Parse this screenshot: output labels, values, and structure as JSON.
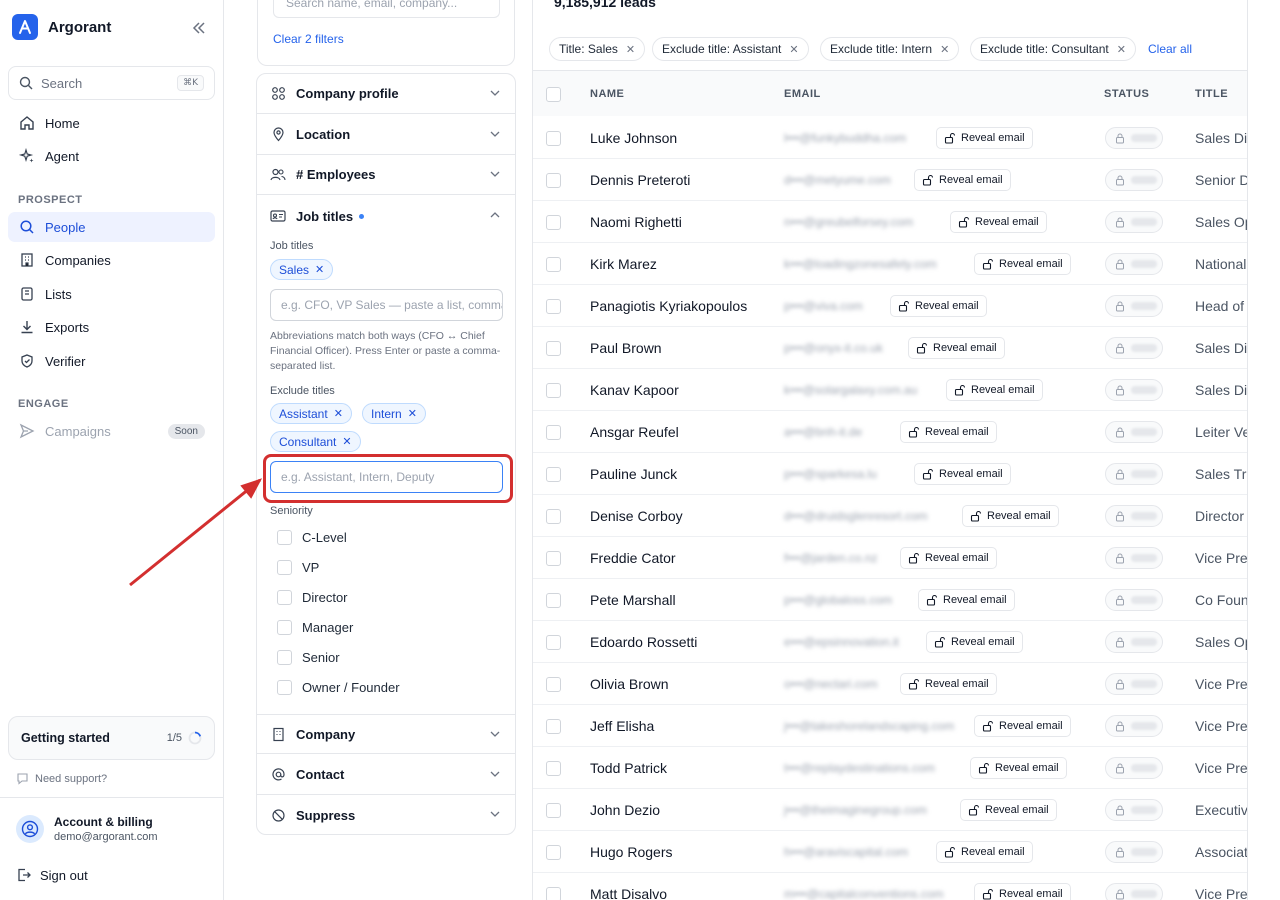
{
  "sidebar": {
    "brand": "Argorant",
    "search_label": "Search",
    "search_kbd": "⌘K",
    "nav_top": [
      {
        "label": "Home",
        "icon": "home-icon"
      },
      {
        "label": "Agent",
        "icon": "sparkle-icon"
      }
    ],
    "prospect_label": "PROSPECT",
    "nav_prospect": [
      {
        "label": "People",
        "icon": "search-icon",
        "active": true
      },
      {
        "label": "Companies",
        "icon": "building-icon"
      },
      {
        "label": "Lists",
        "icon": "list-icon"
      },
      {
        "label": "Exports",
        "icon": "download-icon"
      },
      {
        "label": "Verifier",
        "icon": "shield-icon"
      }
    ],
    "engage_label": "ENGAGE",
    "campaigns_label": "Campaigns",
    "campaigns_badge": "Soon",
    "getting_started": {
      "title": "Getting started",
      "progress": "1/5"
    },
    "support": "Need support?",
    "account_title": "Account & billing",
    "account_email": "demo@argorant.com",
    "signout": "Sign out"
  },
  "filters": {
    "search_placeholder": "Search name, email, company...",
    "clear_filters": "Clear 2 filters",
    "sections": {
      "company_profile": "Company profile",
      "location": "Location",
      "employees": "# Employees",
      "job_titles": "Job titles",
      "company": "Company",
      "contact": "Contact",
      "suppress": "Suppress"
    },
    "job_titles_label": "Job titles",
    "job_titles_chips": [
      "Sales"
    ],
    "job_titles_placeholder": "e.g. CFO, VP Sales — paste a list, comma-separated",
    "help_text": "Abbreviations match both ways (CFO ↔ Chief Financial Officer). Press Enter or paste a comma-separated list.",
    "exclude_label": "Exclude titles",
    "exclude_chips": [
      "Assistant",
      "Intern",
      "Consultant"
    ],
    "exclude_placeholder": "e.g. Assistant, Intern, Deputy",
    "seniority_label": "Seniority",
    "seniority_options": [
      "C-Level",
      "VP",
      "Director",
      "Manager",
      "Senior",
      "Owner / Founder"
    ]
  },
  "main": {
    "lead_count": "9,185,912 leads",
    "active_filters": [
      "Title: Sales",
      "Exclude title: Assistant",
      "Exclude title: Intern",
      "Exclude title: Consultant"
    ],
    "clear_all": "Clear all",
    "columns": [
      "NAME",
      "EMAIL",
      "STATUS",
      "TITLE"
    ],
    "reveal_label": "Reveal email",
    "rows": [
      {
        "name": "Luke Johnson",
        "email": "l•••@funkybuddha.com",
        "title": "Sales Director"
      },
      {
        "name": "Dennis Preteroti",
        "email": "d•••@metyume.com",
        "title": "Senior Director"
      },
      {
        "name": "Naomi Righetti",
        "email": "n•••@greubelforsey.com",
        "title": "Sales Operations"
      },
      {
        "name": "Kirk Marez",
        "email": "k•••@loadingzonesafety.com",
        "title": "National Sales"
      },
      {
        "name": "Panagiotis Kyriakopoulos",
        "email": "p•••@viva.com",
        "title": "Head of Sales"
      },
      {
        "name": "Paul Brown",
        "email": "p•••@onyx-it.co.uk",
        "title": "Sales Director"
      },
      {
        "name": "Kanav Kapoor",
        "email": "k•••@solargalaxy.com.au",
        "title": "Sales Director"
      },
      {
        "name": "Ansgar Reufel",
        "email": "a•••@bnh-it.de",
        "title": "Leiter Vertrieb"
      },
      {
        "name": "Pauline Junck",
        "email": "p•••@sparkesa.lu",
        "title": "Sales Trainer"
      },
      {
        "name": "Denise Corboy",
        "email": "d•••@druidsglenresort.com",
        "title": "Director of Sales"
      },
      {
        "name": "Freddie Cator",
        "email": "f•••@jarden.co.nz",
        "title": "Vice President"
      },
      {
        "name": "Pete Marshall",
        "email": "p•••@globaloss.com",
        "title": "Co Founder"
      },
      {
        "name": "Edoardo Rossetti",
        "email": "e•••@epsinnovation.it",
        "title": "Sales Operations"
      },
      {
        "name": "Olivia Brown",
        "email": "o•••@nectari.com",
        "title": "Vice President"
      },
      {
        "name": "Jeff Elisha",
        "email": "j•••@takeshorelandscaping.com",
        "title": "Vice President"
      },
      {
        "name": "Todd Patrick",
        "email": "t•••@replaydestinations.com",
        "title": "Vice President"
      },
      {
        "name": "John Dezio",
        "email": "j•••@theimaginegroup.com",
        "title": "Executive"
      },
      {
        "name": "Hugo Rogers",
        "email": "h•••@araviscapital.com",
        "title": "Associate"
      },
      {
        "name": "Matt Disalvo",
        "email": "m•••@capitalconventions.com",
        "title": "Vice President"
      }
    ]
  }
}
